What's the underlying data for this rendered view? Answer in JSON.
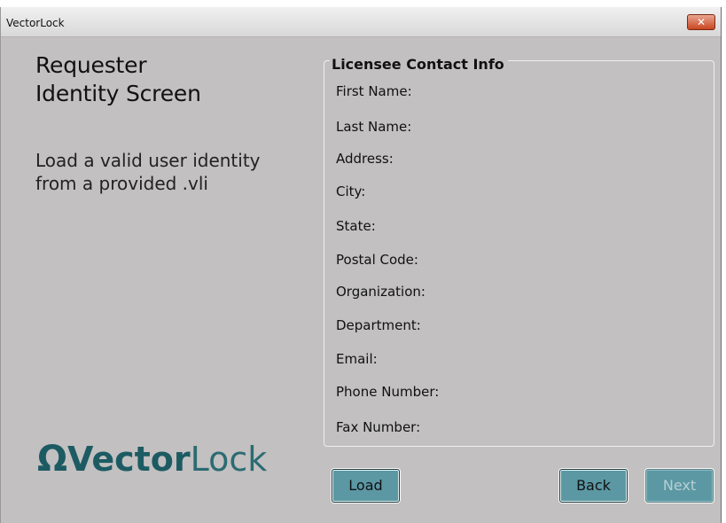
{
  "window": {
    "title": "VectorLock",
    "close_glyph": "✕"
  },
  "left": {
    "heading_lines": [
      "Requester",
      "Identity Screen"
    ],
    "description_lines": [
      "Load a valid user identity",
      "from a provided .vli"
    ],
    "logo": {
      "symbol": "Ω",
      "part1": "Vector",
      "part2": "Lock",
      "color": "#1d5b63"
    }
  },
  "contact": {
    "legend": "Licensee Contact Info",
    "fields": [
      "First Name:",
      "Last Name:",
      "Address:",
      "City:",
      "State:",
      "Postal Code:",
      "Organization:",
      "Department:",
      "Email:",
      "Phone Number:",
      "Fax Number:"
    ]
  },
  "buttons": {
    "load": "Load",
    "back": "Back",
    "next": "Next"
  },
  "colors": {
    "button": "#5b98a4",
    "background": "#c2c0c0"
  }
}
